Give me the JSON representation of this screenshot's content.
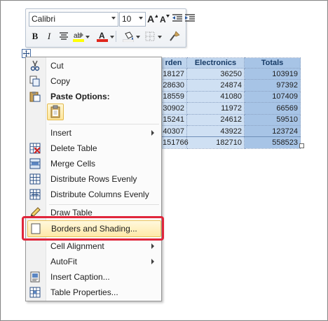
{
  "toolbar": {
    "font_name": "Calibri",
    "font_size": "10",
    "buttons": [
      "grow-font",
      "shrink-font",
      "decrease-indent",
      "increase-indent",
      "bold",
      "italic",
      "center",
      "highlight",
      "font-color",
      "shading",
      "borders",
      "format-painter"
    ]
  },
  "table": {
    "headers": [
      "rden",
      "Electronics",
      "Totals"
    ],
    "rows": [
      [
        "18127",
        "36250",
        "103919"
      ],
      [
        "28630",
        "24874",
        "97392"
      ],
      [
        "18559",
        "41080",
        "107409"
      ],
      [
        "30902",
        "11972",
        "66569"
      ],
      [
        "15241",
        "24612",
        "59510"
      ],
      [
        "40307",
        "43922",
        "123724"
      ],
      [
        "151766",
        "182710",
        "558523"
      ]
    ]
  },
  "menu": {
    "cut": "Cut",
    "copy": "Copy",
    "paste_options": "Paste Options:",
    "insert": "Insert",
    "delete_table": "Delete Table",
    "merge_cells": "Merge Cells",
    "distribute_rows": "Distribute Rows Evenly",
    "distribute_columns": "Distribute Columns Evenly",
    "draw_table": "Draw Table",
    "borders_shading": "Borders and Shading...",
    "cell_alignment": "Cell Alignment",
    "autofit": "AutoFit",
    "insert_caption": "Insert Caption...",
    "table_properties": "Table Properties..."
  },
  "colors": {
    "highlight": "#ffff00",
    "font_color": "#e0261b",
    "callout": "#e0263b",
    "table_selection": "#cfe0f3"
  }
}
